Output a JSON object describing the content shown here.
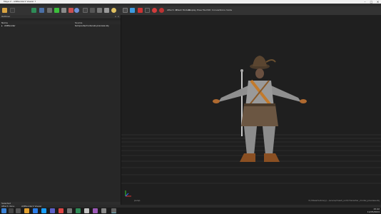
{
  "window": {
    "title": "Maya 2 - ASBlender2 Viewer ?",
    "controls": [
      "–",
      "□",
      "✕"
    ]
  },
  "menu": {
    "items": [
      "File",
      "Edit",
      "Mode",
      "Render",
      "Tools",
      "Options",
      "Help"
    ]
  },
  "toolbar": {
    "labels": [
      "Attach dir",
      "Mesh Models",
      "Display",
      "Pose file",
      "USD",
      "Conventions mode"
    ]
  },
  "outliner": {
    "title": "Outliner",
    "col_name": "Name",
    "col_source": "Source",
    "row_name": "ASBlender",
    "row_source": "tempouts/model.ab.preview.obj",
    "scroll_label": "Selected",
    "btn1": "Fbx",
    "btn2": "Edit"
  },
  "viewport": {
    "bottom_left": "persp",
    "bottom_right": "D:/SteamLibrary/.../scene/mesh_unit/character_model_preview.obj"
  },
  "status": {
    "left": "Attach done",
    "left2": "ASBlender2 Viewer"
  },
  "tray": {
    "time": "15:42",
    "date": "11/05/2024"
  }
}
